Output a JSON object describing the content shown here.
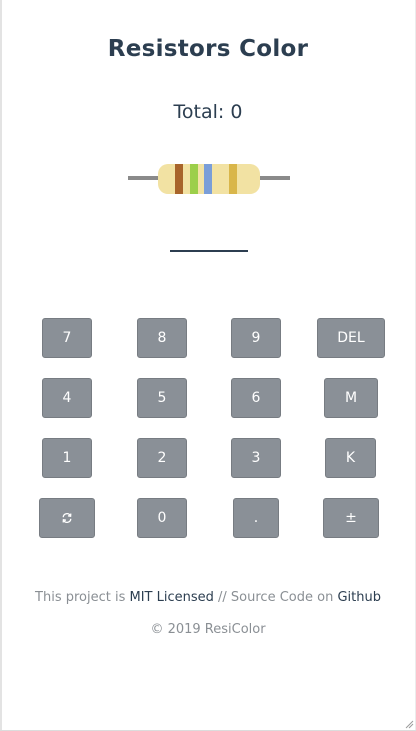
{
  "header": {
    "title": "Resistors Color"
  },
  "total": {
    "text": "Total: 0"
  },
  "resistor": {
    "body_color": "#f2e2a3",
    "lead_color": "#8a8a8a",
    "bands": [
      {
        "name": "band-brown",
        "color": "#a8642a"
      },
      {
        "name": "band-green",
        "color": "#9ccf4a"
      },
      {
        "name": "band-blue",
        "color": "#7a9ed8"
      },
      {
        "name": "band-gold",
        "color": "#d9b64a"
      }
    ]
  },
  "keypad": {
    "keys": [
      {
        "name": "key-7",
        "label": "7"
      },
      {
        "name": "key-8",
        "label": "8"
      },
      {
        "name": "key-9",
        "label": "9"
      },
      {
        "name": "key-del",
        "label": "DEL"
      },
      {
        "name": "key-4",
        "label": "4"
      },
      {
        "name": "key-5",
        "label": "5"
      },
      {
        "name": "key-6",
        "label": "6"
      },
      {
        "name": "key-mega",
        "label": "M"
      },
      {
        "name": "key-1",
        "label": "1"
      },
      {
        "name": "key-2",
        "label": "2"
      },
      {
        "name": "key-3",
        "label": "3"
      },
      {
        "name": "key-kilo",
        "label": "K"
      },
      {
        "name": "key-reset",
        "icon": "refresh-icon"
      },
      {
        "name": "key-0",
        "label": "0"
      },
      {
        "name": "key-dot",
        "label": "."
      },
      {
        "name": "key-plus-minus",
        "label": "±"
      }
    ]
  },
  "footer": {
    "prefix": "This project is ",
    "license_link": "MIT Licensed",
    "middle": " // Source Code on ",
    "github_link": "Github",
    "copyright": "© 2019 ResiColor"
  },
  "colors": {
    "text": "#2c3e50",
    "key_bg": "#8a9097",
    "muted": "#8a8f94"
  }
}
